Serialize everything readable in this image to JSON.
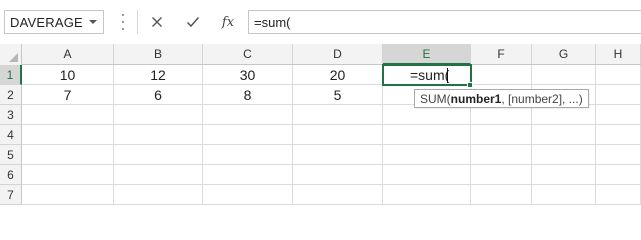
{
  "formula_bar": {
    "name_box_value": "DAVERAGE",
    "cancel_icon": "close-icon",
    "enter_icon": "checkmark-icon",
    "function_label": "fx",
    "formula_value": "=sum("
  },
  "columns": [
    "A",
    "B",
    "C",
    "D",
    "E",
    "F",
    "G",
    "H"
  ],
  "rows": [
    "1",
    "2",
    "3",
    "4",
    "5",
    "6",
    "7"
  ],
  "cells": {
    "A1": "10",
    "B1": "12",
    "C1": "30",
    "D1": "20",
    "E1": "=sum(",
    "A2": "7",
    "B2": "6",
    "C2": "8",
    "D2": "5"
  },
  "active_cell": "E1",
  "tooltip": {
    "prefix": "SUM(",
    "arg_current": "number1",
    "rest": ", [number2], ...)"
  },
  "colors": {
    "accent": "#217346",
    "header_bg": "#f3f3f3",
    "active_header_bg": "#d6d6d6",
    "gridline": "#dcdcdc"
  }
}
